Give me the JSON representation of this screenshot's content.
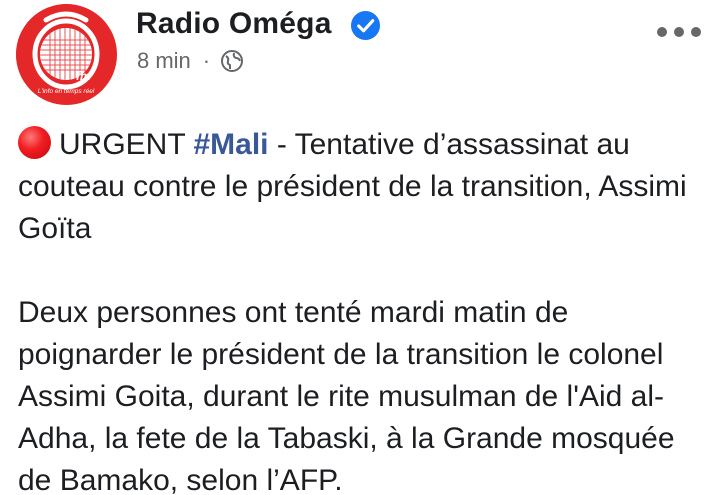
{
  "post": {
    "page_name": "Radio Oméga",
    "verified": true,
    "time": "8 min",
    "separator": "·",
    "audience_icon": "globe-icon",
    "more_icon": "more-options-icon",
    "avatar": {
      "logo_text": "fm",
      "tagline": "L'info en temps réel",
      "background_color": "#e4282a"
    },
    "body": {
      "urgent_icon": "red-circle-icon",
      "urgent_prefix": "URGENT",
      "hashtag": "#Mali",
      "headline_rest": " - Tentative d’assassinat au couteau contre le président de la transition, Assimi Goïta",
      "paragraph": "Deux personnes ont tenté mardi matin de poignarder le président de la transition le colonel Assimi Goita, durant le rite musulman de l'Aid al-Adha, la fete de la Tabaski, à la Grande mosquée de Bamako, selon l’AFP."
    }
  },
  "colors": {
    "text": "#1c1e21",
    "meta": "#65676b",
    "hashtag": "#385898",
    "verified_badge": "#1877f2",
    "urgent_red": "#f11d22"
  }
}
